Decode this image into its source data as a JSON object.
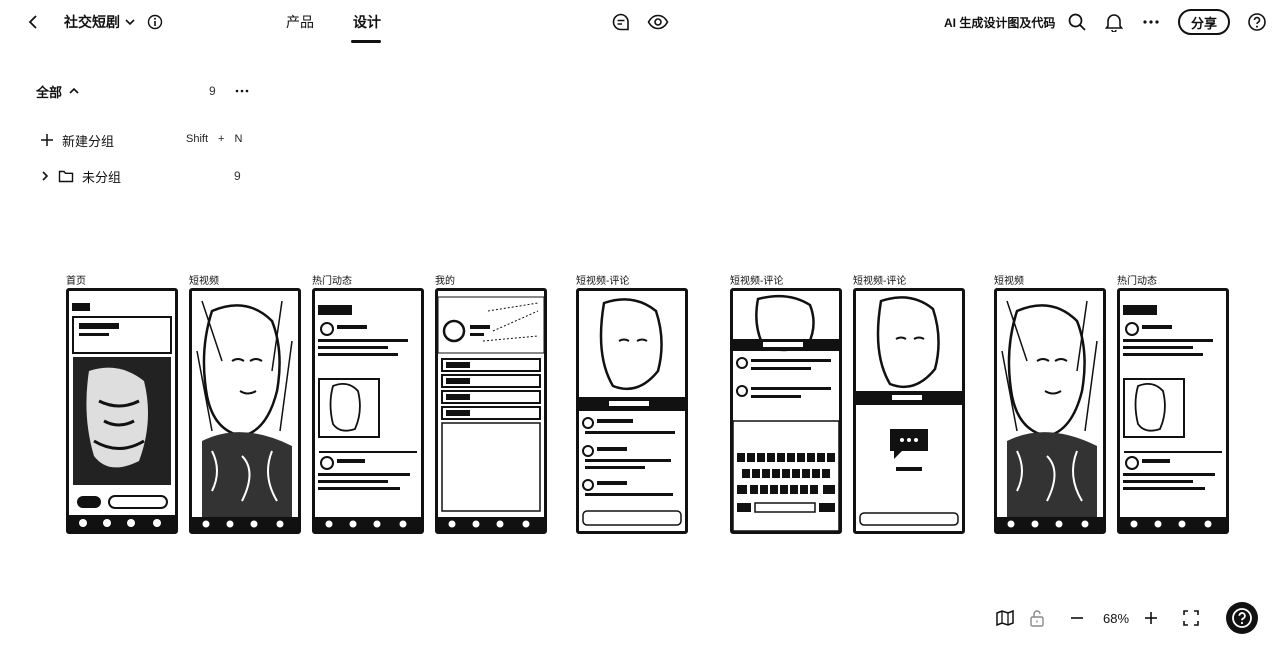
{
  "topbar": {
    "project_name": "社交短剧",
    "tabs": [
      {
        "label": "产品",
        "active": false
      },
      {
        "label": "设计",
        "active": true
      }
    ],
    "ai_label": "AI 生成设计图及代码",
    "share_label": "分享"
  },
  "panel": {
    "all_label": "全部",
    "all_count": "9",
    "new_group_label": "新建分组",
    "shortcut_keys": [
      "Shift",
      "+",
      "N"
    ],
    "groups": [
      {
        "label": "未分组",
        "count": "9"
      }
    ]
  },
  "frames": [
    {
      "label": "首页",
      "kind": "home"
    },
    {
      "label": "短视频",
      "kind": "portrait"
    },
    {
      "label": "热门动态",
      "kind": "feed"
    },
    {
      "label": "我的",
      "kind": "profile"
    },
    {
      "label": "短视频-评论",
      "kind": "comments"
    },
    {
      "label": "短视频-评论",
      "kind": "keyboard"
    },
    {
      "label": "短视频-评论",
      "kind": "empty"
    },
    {
      "label": "短视频",
      "kind": "portrait"
    },
    {
      "label": "热门动态",
      "kind": "feed"
    }
  ],
  "bottombar": {
    "zoom": "68%"
  },
  "colors": {
    "ink": "#111111",
    "background": "#ffffff"
  }
}
